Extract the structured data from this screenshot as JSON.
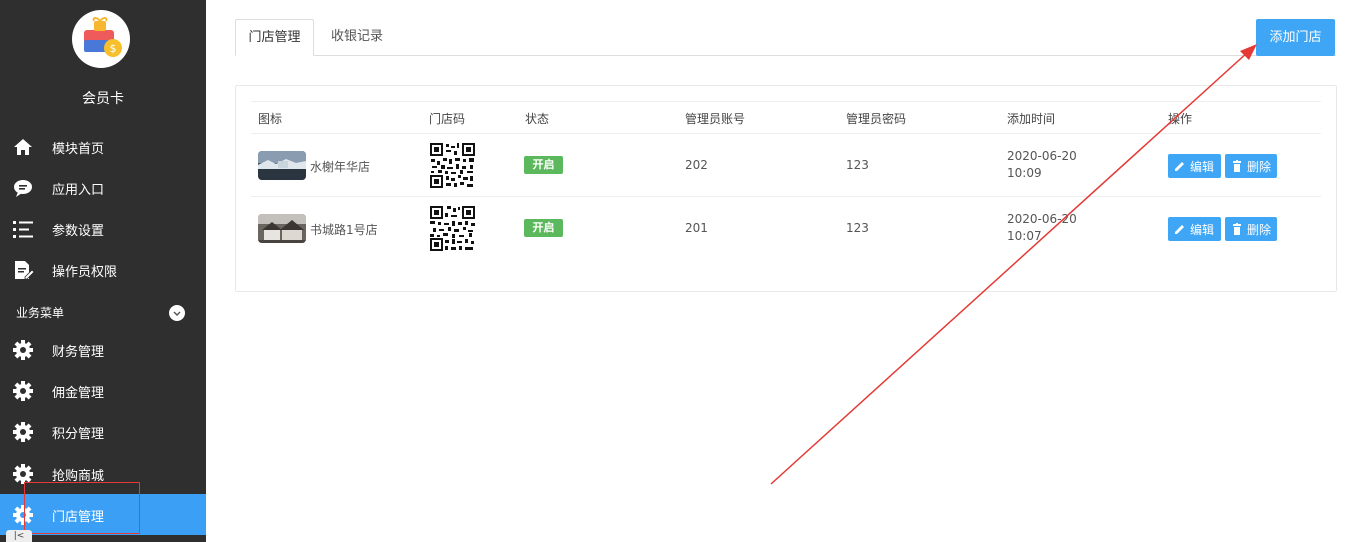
{
  "sidebar": {
    "app_name": "会员卡",
    "items": [
      {
        "label": "模块首页",
        "icon": "home-icon"
      },
      {
        "label": "应用入口",
        "icon": "chat-bubble-icon"
      },
      {
        "label": "参数设置",
        "icon": "list-icon"
      },
      {
        "label": "操作员权限",
        "icon": "document-edit-icon"
      }
    ],
    "section_title": "业务菜单",
    "business_items": [
      {
        "label": "财务管理",
        "icon": "gear-icon"
      },
      {
        "label": "佣金管理",
        "icon": "gear-icon"
      },
      {
        "label": "积分管理",
        "icon": "gear-icon"
      },
      {
        "label": "抢购商城",
        "icon": "gear-icon"
      },
      {
        "label": "门店管理",
        "icon": "gear-icon",
        "active": true
      }
    ]
  },
  "tabs": [
    {
      "label": "门店管理",
      "active": true
    },
    {
      "label": "收银记录",
      "active": false
    }
  ],
  "add_button": "添加门店",
  "table": {
    "columns": [
      "图标",
      "门店码",
      "状态",
      "管理员账号",
      "管理员密码",
      "添加时间",
      "操作"
    ],
    "rows": [
      {
        "name": "水榭年华店",
        "status": "开启",
        "account": "202",
        "password": "123",
        "date": "2020-06-20",
        "time": "10:09"
      },
      {
        "name": "书城路1号店",
        "status": "开启",
        "account": "201",
        "password": "123",
        "date": "2020-06-20",
        "time": "10:07"
      }
    ],
    "edit_label": "编辑",
    "delete_label": "删除"
  },
  "colors": {
    "sidebar_bg": "#2f2f2f",
    "accent": "#3ea6f5",
    "status_green": "#5cb85c",
    "annotation_red": "#e53935"
  }
}
